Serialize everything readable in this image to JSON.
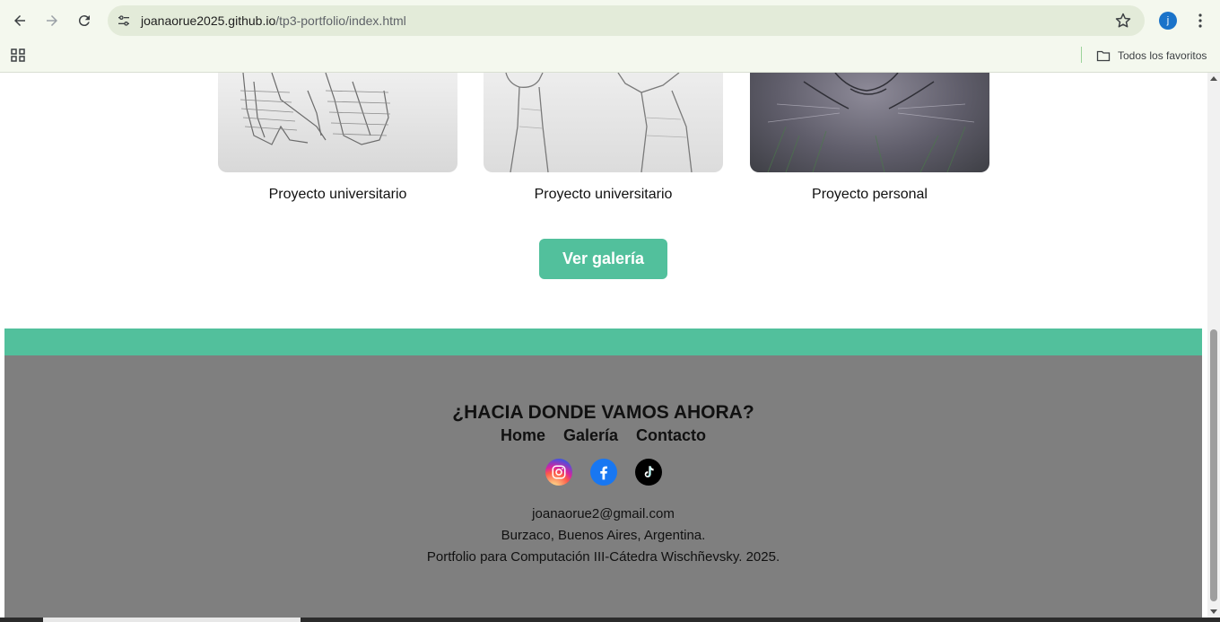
{
  "browser": {
    "url_domain": "joanaorue2025.github.io",
    "url_path": "/tp3-portfolio/index.html",
    "profile_initial": "j",
    "bookmarks_folder": "Todos los favoritos"
  },
  "projects": [
    {
      "caption": "Proyecto universitario"
    },
    {
      "caption": "Proyecto universitario"
    },
    {
      "caption": "Proyecto personal"
    }
  ],
  "gallery_button": "Ver galería",
  "footer": {
    "title": "¿HACIA DONDE VAMOS AHORA?",
    "nav": [
      "Home",
      "Galería",
      "Contacto"
    ],
    "socials": [
      "instagram-icon",
      "facebook-icon",
      "tiktok-icon"
    ],
    "email": "joanaorue2@gmail.com",
    "location": "Burzaco, Buenos Aires, Argentina.",
    "credits": "Portfolio para Computación III-Cátedra Wischñevsky. 2025."
  },
  "colors": {
    "accent": "#52c09c",
    "footer_bg": "#7f7f7f"
  }
}
